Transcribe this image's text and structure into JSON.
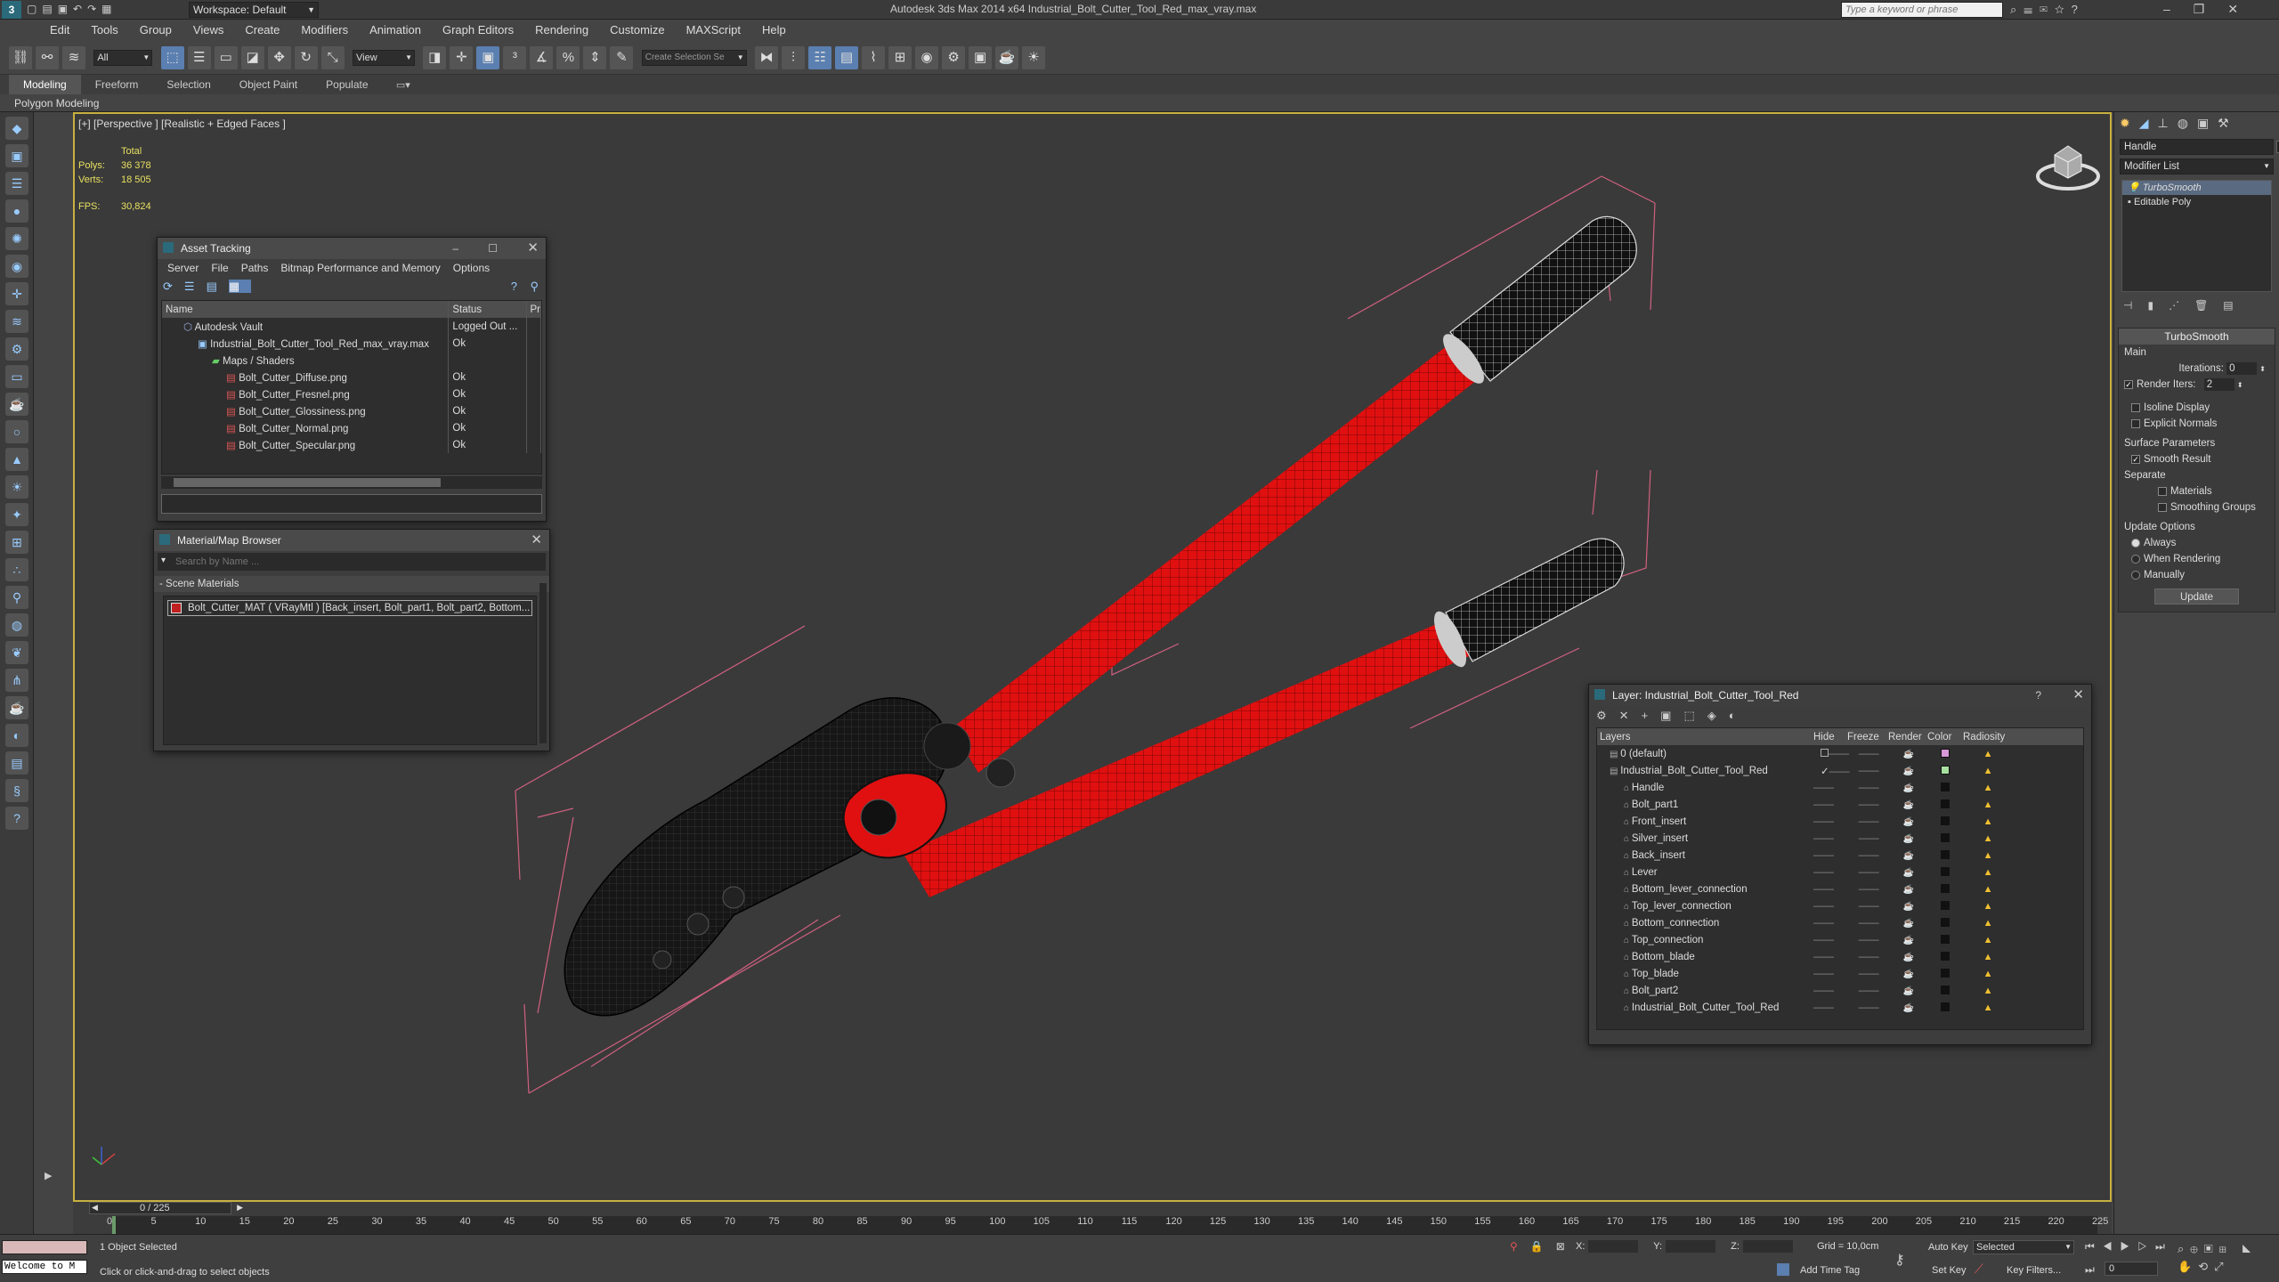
{
  "app": {
    "workspace_label": "Workspace: Default",
    "title": "Autodesk 3ds Max  2014 x64     Industrial_Bolt_Cutter_Tool_Red_max_vray.max",
    "search_placeholder": "Type a keyword or phrase"
  },
  "menu": [
    "Edit",
    "Tools",
    "Group",
    "Views",
    "Create",
    "Modifiers",
    "Animation",
    "Graph Editors",
    "Rendering",
    "Customize",
    "MAXScript",
    "Help"
  ],
  "toolbar": {
    "filter_value": "All",
    "refcoord_value": "View",
    "named_selection_placeholder": "Create Selection Se"
  },
  "ribbon": {
    "tabs": [
      "Modeling",
      "Freeform",
      "Selection",
      "Object Paint",
      "Populate"
    ],
    "active_tab": "Modeling",
    "sub_label": "Polygon Modeling"
  },
  "viewport": {
    "label": "[+] [Perspective ] [Realistic + Edged Faces ]",
    "stats": {
      "total_label": "Total",
      "polys_label": "Polys:",
      "polys": "36 378",
      "verts_label": "Verts:",
      "verts": "18 505",
      "fps_label": "FPS:",
      "fps": "30,824"
    }
  },
  "asset_tracking": {
    "title": "Asset Tracking",
    "menu": [
      "Server",
      "File",
      "Paths",
      "Bitmap Performance and Memory",
      "Options"
    ],
    "columns": [
      "Name",
      "Status",
      "Pr"
    ],
    "rows": [
      {
        "name": "Autodesk Vault",
        "status": "Logged Out ..."
      },
      {
        "name": "Industrial_Bolt_Cutter_Tool_Red_max_vray.max",
        "status": "Ok"
      },
      {
        "name": "Maps / Shaders",
        "status": ""
      },
      {
        "name": "Bolt_Cutter_Diffuse.png",
        "status": "Ok"
      },
      {
        "name": "Bolt_Cutter_Fresnel.png",
        "status": "Ok"
      },
      {
        "name": "Bolt_Cutter_Glossiness.png",
        "status": "Ok"
      },
      {
        "name": "Bolt_Cutter_Normal.png",
        "status": "Ok"
      },
      {
        "name": "Bolt_Cutter_Specular.png",
        "status": "Ok"
      }
    ]
  },
  "material_browser": {
    "title": "Material/Map Browser",
    "search_placeholder": "Search by Name ...",
    "section": "- Scene Materials",
    "item": "Bolt_Cutter_MAT ( VRayMtl ) [Back_insert, Bolt_part1, Bolt_part2, Bottom..."
  },
  "layer_explorer": {
    "title": "Layer: Industrial_Bolt_Cutter_Tool_Red",
    "help": "?",
    "columns": [
      "Layers",
      "Hide",
      "Freeze",
      "Render",
      "Color",
      "Radiosity"
    ],
    "rows": [
      {
        "name": "0 (default)",
        "color": "#d898d8"
      },
      {
        "name": "Industrial_Bolt_Cutter_Tool_Red",
        "color": "#a8e0a0"
      },
      {
        "name": "Handle",
        "color": "#111111"
      },
      {
        "name": "Bolt_part1",
        "color": "#111111"
      },
      {
        "name": "Front_insert",
        "color": "#111111"
      },
      {
        "name": "Silver_insert",
        "color": "#111111"
      },
      {
        "name": "Back_insert",
        "color": "#111111"
      },
      {
        "name": "Lever",
        "color": "#111111"
      },
      {
        "name": "Bottom_lever_connection",
        "color": "#111111"
      },
      {
        "name": "Top_lever_connection",
        "color": "#111111"
      },
      {
        "name": "Bottom_connection",
        "color": "#111111"
      },
      {
        "name": "Top_connection",
        "color": "#111111"
      },
      {
        "name": "Bottom_blade",
        "color": "#111111"
      },
      {
        "name": "Top_blade",
        "color": "#111111"
      },
      {
        "name": "Bolt_part2",
        "color": "#111111"
      },
      {
        "name": "Industrial_Bolt_Cutter_Tool_Red",
        "color": "#111111"
      }
    ]
  },
  "command_panel": {
    "object_name": "Handle",
    "modifier_list": "Modifier List",
    "stack": [
      "TurboSmooth",
      "Editable Poly"
    ],
    "rollout_title": "TurboSmooth",
    "main_label": "Main",
    "iterations_label": "Iterations:",
    "iterations": "0",
    "render_iters_label": "Render Iters:",
    "render_iters": "2",
    "isoline": "Isoline Display",
    "explicit": "Explicit Normals",
    "surface_params": "Surface Parameters",
    "smooth_result": "Smooth Result",
    "separate": "Separate",
    "materials": "Materials",
    "smoothing_groups": "Smoothing Groups",
    "update_options": "Update Options",
    "always": "Always",
    "when_rendering": "When Rendering",
    "manually": "Manually",
    "update_button": "Update"
  },
  "timeline": {
    "frame": "0 / 225",
    "ticks": [
      "0",
      "5",
      "10",
      "15",
      "20",
      "25",
      "30",
      "35",
      "40",
      "45",
      "50",
      "55",
      "60",
      "65",
      "70",
      "75",
      "80",
      "85",
      "90",
      "95",
      "100",
      "105",
      "110",
      "115",
      "120",
      "125",
      "130",
      "135",
      "140",
      "145",
      "150",
      "155",
      "160",
      "165",
      "170",
      "175",
      "180",
      "185",
      "190",
      "195",
      "200",
      "205",
      "210",
      "215",
      "220",
      "225"
    ]
  },
  "status": {
    "maxscript": "Welcome to M",
    "selected": "1 Object Selected",
    "prompt": "Click or click-and-drag to select objects",
    "x_label": "X:",
    "y_label": "Y:",
    "z_label": "Z:",
    "grid": "Grid = 10,0cm",
    "add_time_tag": "Add Time Tag",
    "auto_key": "Auto Key",
    "auto_key_value": "Selected",
    "set_key": "Set Key",
    "key_filters": "Key Filters...",
    "frame_field": "0"
  },
  "colors": {
    "accent": "#5a7fb0",
    "viewport_border": "#c8b040",
    "model_red": "#e01010",
    "bbox": "#d06080"
  }
}
